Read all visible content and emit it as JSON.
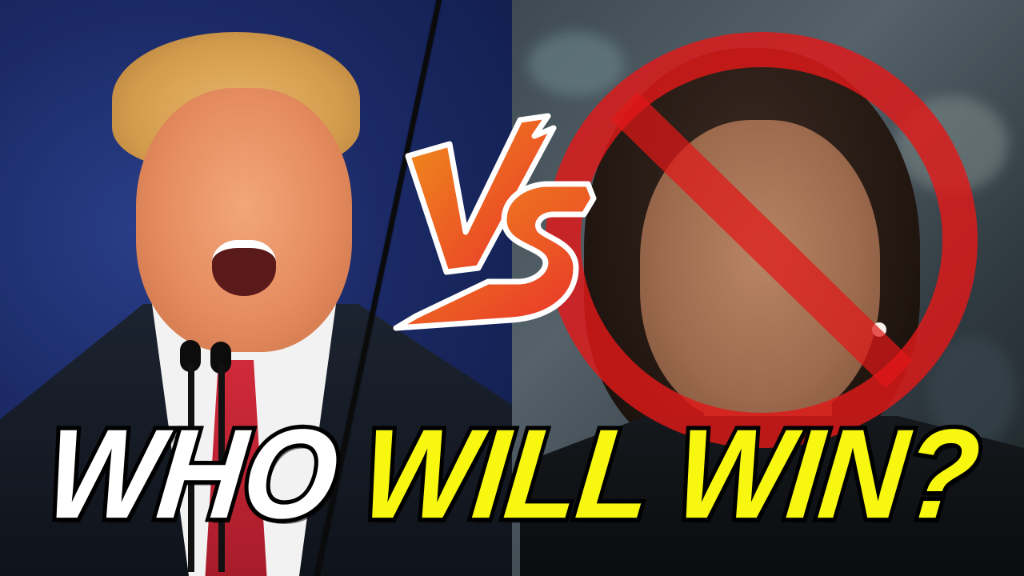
{
  "thumbnail": {
    "badge": {
      "text": "VS",
      "colors": {
        "start": "#f0901c",
        "end": "#e8302a"
      }
    },
    "headline": {
      "word_1": "WHO",
      "word_2": "WILL",
      "word_3": "WIN?",
      "colors": {
        "white": "#ffffff",
        "yellow": "#f7f70f"
      }
    },
    "prohibition_sign_color": "#e01818"
  }
}
